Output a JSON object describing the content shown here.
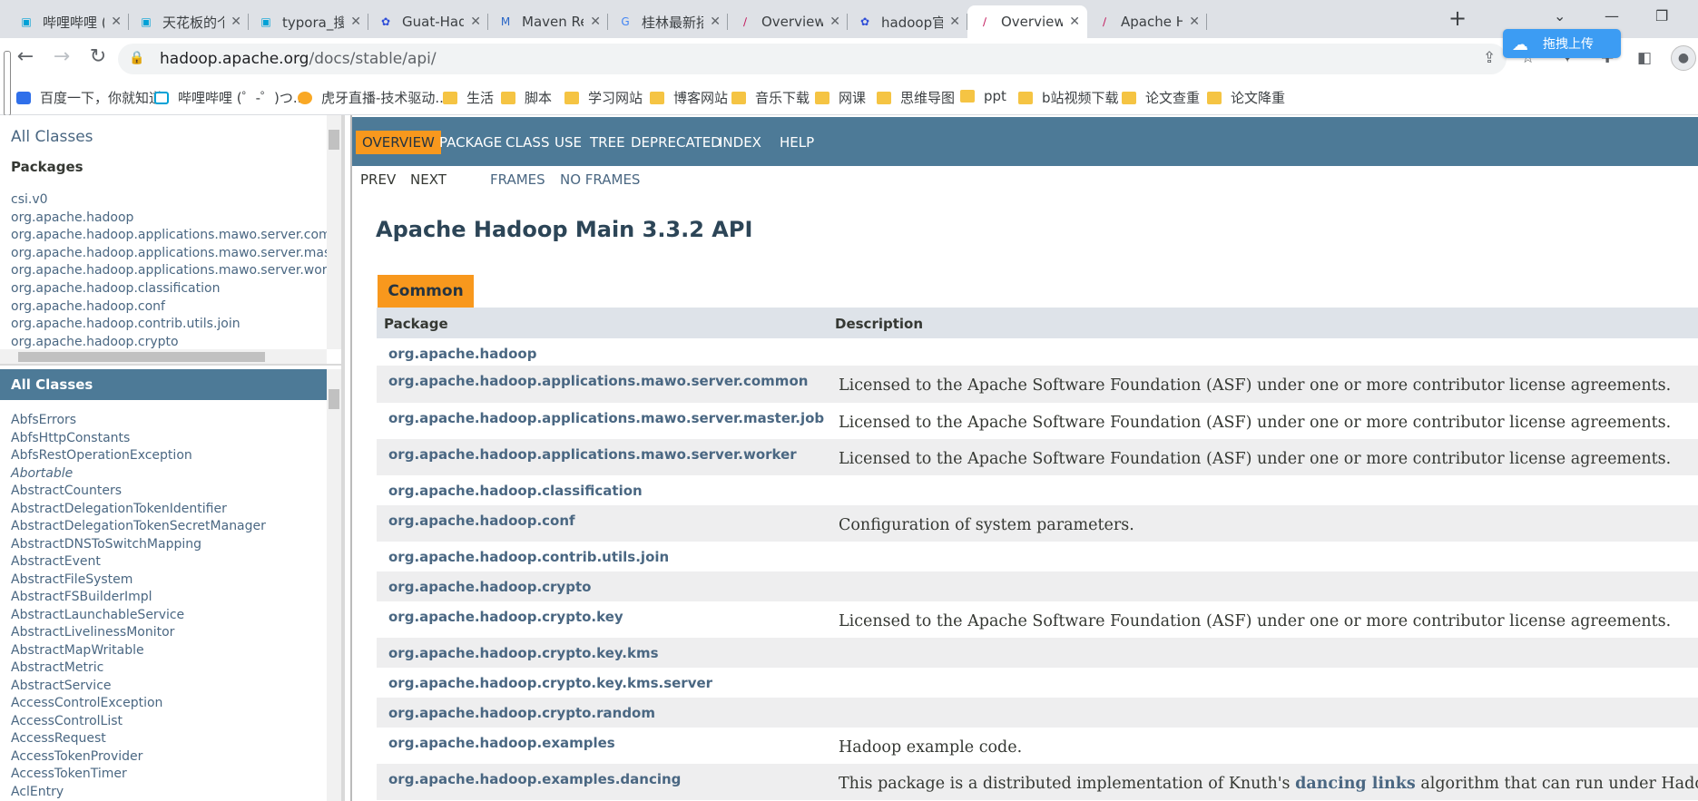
{
  "browser": {
    "tabs": [
      {
        "title": "哔哩哔哩 (",
        "icon": "bilibili-icon"
      },
      {
        "title": "天花板的个",
        "icon": "bilibili-icon"
      },
      {
        "title": "typora_搜",
        "icon": "bilibili-icon"
      },
      {
        "title": "Guat-Hado",
        "icon": "baidu-icon"
      },
      {
        "title": "Maven Rep",
        "icon": "mvn-icon"
      },
      {
        "title": "桂林最新招",
        "icon": "google-icon"
      },
      {
        "title": "Overview (",
        "icon": "apache-feather-icon"
      },
      {
        "title": "hadoop官",
        "icon": "baidu-icon"
      },
      {
        "title": "Overview (",
        "icon": "apache-feather-icon",
        "active": true
      },
      {
        "title": "Apache Ha",
        "icon": "apache-feather-icon"
      }
    ],
    "new_tab": "+",
    "url_host": "hadoop.apache.org",
    "url_path": "/docs/stable/api/",
    "upload_label": "拖拽上传",
    "bookmarks": [
      {
        "label": "百度一下，你就知道",
        "icon": "baidu-icon"
      },
      {
        "label": "哔哩哔哩 (゜-゜)つ...",
        "icon": "bilibili-icon"
      },
      {
        "label": "虎牙直播-技术驱动...",
        "icon": "huya-icon"
      },
      {
        "label": "生活",
        "icon": "folder-icon"
      },
      {
        "label": "脚本",
        "icon": "folder-icon"
      },
      {
        "label": "学习网站",
        "icon": "folder-icon"
      },
      {
        "label": "博客网站",
        "icon": "folder-icon"
      },
      {
        "label": "音乐下载",
        "icon": "folder-icon"
      },
      {
        "label": "网课",
        "icon": "folder-icon"
      },
      {
        "label": "思维导图",
        "icon": "folder-icon"
      },
      {
        "label": "ppt",
        "icon": "folder-icon"
      },
      {
        "label": "b站视频下载",
        "icon": "folder-icon"
      },
      {
        "label": "论文查重",
        "icon": "folder-icon"
      },
      {
        "label": "论文降重",
        "icon": "folder-icon"
      }
    ]
  },
  "packages_frame": {
    "all_classes_link": "All Classes",
    "heading": "Packages",
    "items": [
      "csi.v0",
      "org.apache.hadoop",
      "org.apache.hadoop.applications.mawo.server.common",
      "org.apache.hadoop.applications.mawo.server.master",
      "org.apache.hadoop.applications.mawo.server.worker",
      "org.apache.hadoop.classification",
      "org.apache.hadoop.conf",
      "org.apache.hadoop.contrib.utils.join",
      "org.apache.hadoop.crypto"
    ]
  },
  "classes_frame": {
    "heading": "All Classes",
    "items": [
      {
        "name": "AbfsErrors"
      },
      {
        "name": "AbfsHttpConstants"
      },
      {
        "name": "AbfsRestOperationException"
      },
      {
        "name": "Abortable",
        "italic": true
      },
      {
        "name": "AbstractCounters"
      },
      {
        "name": "AbstractDelegationTokenIdentifier"
      },
      {
        "name": "AbstractDelegationTokenSecretManager"
      },
      {
        "name": "AbstractDNSToSwitchMapping"
      },
      {
        "name": "AbstractEvent"
      },
      {
        "name": "AbstractFileSystem"
      },
      {
        "name": "AbstractFSBuilderImpl"
      },
      {
        "name": "AbstractLaunchableService"
      },
      {
        "name": "AbstractLivelinessMonitor"
      },
      {
        "name": "AbstractMapWritable"
      },
      {
        "name": "AbstractMetric"
      },
      {
        "name": "AbstractService"
      },
      {
        "name": "AccessControlException"
      },
      {
        "name": "AccessControlList"
      },
      {
        "name": "AccessRequest"
      },
      {
        "name": "AccessTokenProvider"
      },
      {
        "name": "AccessTokenTimer"
      },
      {
        "name": "AclEntry"
      }
    ]
  },
  "main": {
    "nav": [
      "OVERVIEW",
      "PACKAGE",
      "CLASS",
      "USE",
      "TREE",
      "DEPRECATED",
      "INDEX",
      "HELP"
    ],
    "subnav": {
      "prev": "PREV",
      "next": "NEXT",
      "frames": "FRAMES",
      "no_frames": "NO FRAMES"
    },
    "title": "Apache Hadoop Main 3.3.2 API",
    "caption": "Common",
    "col_package": "Package",
    "col_description": "Description",
    "rows": [
      {
        "pkg": "org.apache.hadoop",
        "desc": ""
      },
      {
        "pkg": "org.apache.hadoop.applications.mawo.server.common",
        "desc": "Licensed to the Apache Software Foundation (ASF) under one or more contributor license agreements."
      },
      {
        "pkg": "org.apache.hadoop.applications.mawo.server.master.job",
        "desc": "Licensed to the Apache Software Foundation (ASF) under one or more contributor license agreements."
      },
      {
        "pkg": "org.apache.hadoop.applications.mawo.server.worker",
        "desc": "Licensed to the Apache Software Foundation (ASF) under one or more contributor license agreements."
      },
      {
        "pkg": "org.apache.hadoop.classification",
        "desc": ""
      },
      {
        "pkg": "org.apache.hadoop.conf",
        "desc": "Configuration of system parameters."
      },
      {
        "pkg": "org.apache.hadoop.contrib.utils.join",
        "desc": ""
      },
      {
        "pkg": "org.apache.hadoop.crypto",
        "desc": ""
      },
      {
        "pkg": "org.apache.hadoop.crypto.key",
        "desc": "Licensed to the Apache Software Foundation (ASF) under one or more contributor license agreements."
      },
      {
        "pkg": "org.apache.hadoop.crypto.key.kms",
        "desc": ""
      },
      {
        "pkg": "org.apache.hadoop.crypto.key.kms.server",
        "desc": ""
      },
      {
        "pkg": "org.apache.hadoop.crypto.random",
        "desc": ""
      },
      {
        "pkg": "org.apache.hadoop.examples",
        "desc": "Hadoop example code."
      },
      {
        "pkg": "org.apache.hadoop.examples.dancing",
        "desc_pre": "This package is a distributed implementation of Knuth's ",
        "desc_link": "dancing links",
        "desc_post": " algorithm that can run under Hadoop."
      }
    ]
  }
}
